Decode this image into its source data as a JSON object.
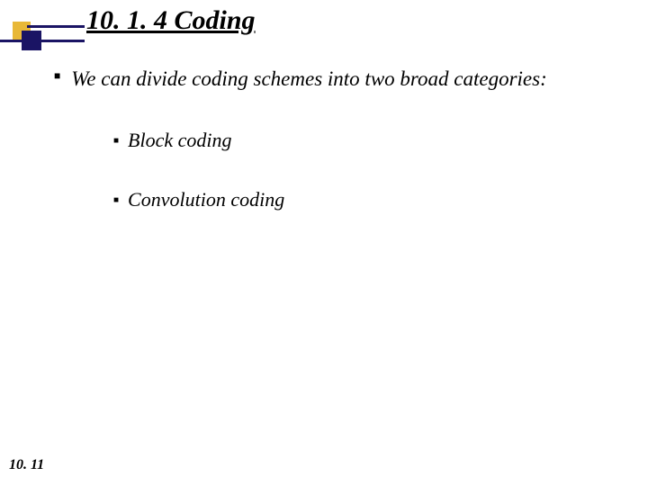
{
  "header": {
    "title": "10. 1. 4  Coding"
  },
  "content": {
    "intro": "We can divide coding schemes into two broad categories:",
    "items": [
      {
        "label": "Block coding"
      },
      {
        "label": "Convolution coding"
      }
    ]
  },
  "page_number": "10. 11"
}
